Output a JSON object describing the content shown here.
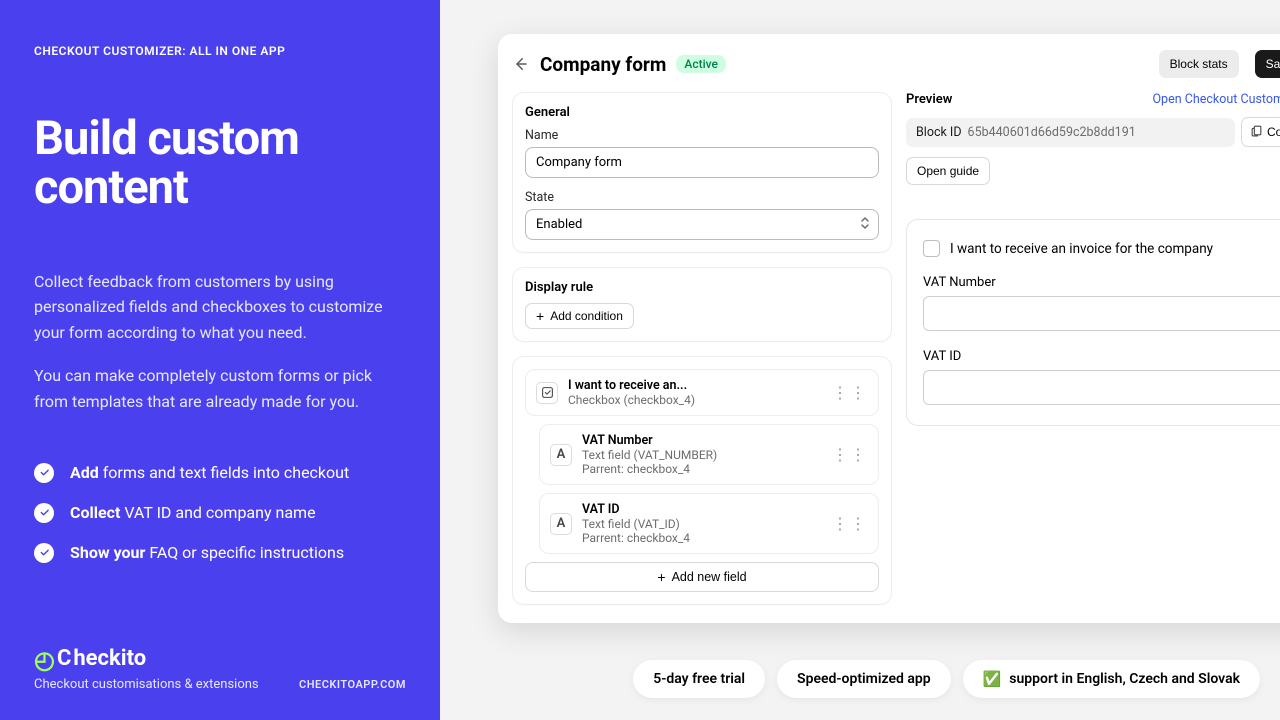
{
  "left": {
    "tag": "CHECKOUT CUSTOMIZER: ALL IN ONE APP",
    "heading": "Build custom content",
    "p1": "Collect feedback from customers by using personalized fields and checkboxes to customize your form according to what you need.",
    "p2": "You can make completely custom forms or pick from templates that are already made for you.",
    "bullets": [
      {
        "bold": "Add",
        "rest": " forms and text fields into checkout"
      },
      {
        "bold": "Collect",
        "rest": " VAT ID and company name"
      },
      {
        "bold": "Show your",
        "rest": " FAQ or specific instructions"
      }
    ],
    "brand": "heckito",
    "brand_sub": "Checkout customisations & extensions",
    "website": "CHECKITOAPP.COM"
  },
  "header": {
    "title": "Company form",
    "badge": "Active",
    "block_stats": "Block stats",
    "save": "Save"
  },
  "general": {
    "title": "General",
    "name_label": "Name",
    "name_value": "Company form",
    "state_label": "State",
    "state_value": "Enabled"
  },
  "display_rule": {
    "title": "Display rule",
    "add": "Add condition"
  },
  "fields": {
    "items": [
      {
        "icon": "checkbox",
        "title": "I want to receive an...",
        "sub1": "Checkbox (checkbox_4)"
      },
      {
        "icon": "A",
        "title": "VAT Number",
        "sub1": "Text field (VAT_NUMBER)",
        "sub2": "Parrent: checkbox_4"
      },
      {
        "icon": "A",
        "title": "VAT ID",
        "sub1": "Text field (VAT_ID)",
        "sub2": "Parrent: checkbox_4"
      }
    ],
    "add_new": "Add new field"
  },
  "preview": {
    "title": "Preview",
    "open_link": "Open Checkout Customizer",
    "block_id_label": "Block ID",
    "block_id_value": "65b440601d66d59c2b8dd191",
    "copy": "Copy",
    "open_guide": "Open guide",
    "check_label": "I want to receive an invoice for the company",
    "vat_number_label": "VAT Number",
    "vat_id_label": "VAT ID"
  },
  "pills": {
    "trial": "5-day free trial",
    "speed": "Speed-optimized app",
    "lang": "support in English, Czech and Slovak"
  }
}
